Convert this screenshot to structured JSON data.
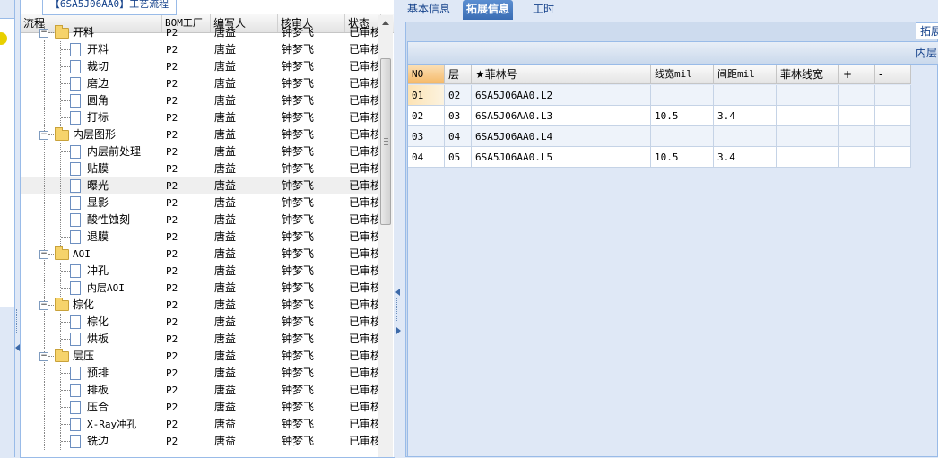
{
  "window": {
    "panel_tab_title": "【6SA5J06AA0】工艺流程"
  },
  "tree": {
    "columns": [
      "流程",
      "BOM工厂",
      "编写人",
      "核审人",
      "状态"
    ],
    "rows": [
      {
        "name": "开料",
        "type": "folder",
        "level": 0,
        "factory": "P2",
        "author": "唐益",
        "reviewer": "钟梦飞",
        "status": "已审核"
      },
      {
        "name": "开料",
        "type": "doc",
        "level": 1,
        "factory": "P2",
        "author": "唐益",
        "reviewer": "钟梦飞",
        "status": "已审核"
      },
      {
        "name": "裁切",
        "type": "doc",
        "level": 1,
        "factory": "P2",
        "author": "唐益",
        "reviewer": "钟梦飞",
        "status": "已审核"
      },
      {
        "name": "磨边",
        "type": "doc",
        "level": 1,
        "factory": "P2",
        "author": "唐益",
        "reviewer": "钟梦飞",
        "status": "已审核"
      },
      {
        "name": "圆角",
        "type": "doc",
        "level": 1,
        "factory": "P2",
        "author": "唐益",
        "reviewer": "钟梦飞",
        "status": "已审核"
      },
      {
        "name": "打标",
        "type": "doc",
        "level": 1,
        "factory": "P2",
        "author": "唐益",
        "reviewer": "钟梦飞",
        "status": "已审核"
      },
      {
        "name": "内层图形",
        "type": "folder",
        "level": 0,
        "factory": "P2",
        "author": "唐益",
        "reviewer": "钟梦飞",
        "status": "已审核"
      },
      {
        "name": "内层前处理",
        "type": "doc",
        "level": 1,
        "factory": "P2",
        "author": "唐益",
        "reviewer": "钟梦飞",
        "status": "已审核"
      },
      {
        "name": "贴膜",
        "type": "doc",
        "level": 1,
        "factory": "P2",
        "author": "唐益",
        "reviewer": "钟梦飞",
        "status": "已审核"
      },
      {
        "name": "曝光",
        "type": "doc",
        "level": 1,
        "factory": "P2",
        "author": "唐益",
        "reviewer": "钟梦飞",
        "status": "已审核",
        "selected": true
      },
      {
        "name": "显影",
        "type": "doc",
        "level": 1,
        "factory": "P2",
        "author": "唐益",
        "reviewer": "钟梦飞",
        "status": "已审核"
      },
      {
        "name": "酸性蚀刻",
        "type": "doc",
        "level": 1,
        "factory": "P2",
        "author": "唐益",
        "reviewer": "钟梦飞",
        "status": "已审核"
      },
      {
        "name": "退膜",
        "type": "doc",
        "level": 1,
        "factory": "P2",
        "author": "唐益",
        "reviewer": "钟梦飞",
        "status": "已审核"
      },
      {
        "name": "AOI",
        "type": "folder",
        "level": 0,
        "factory": "P2",
        "author": "唐益",
        "reviewer": "钟梦飞",
        "status": "已审核"
      },
      {
        "name": "冲孔",
        "type": "doc",
        "level": 1,
        "factory": "P2",
        "author": "唐益",
        "reviewer": "钟梦飞",
        "status": "已审核"
      },
      {
        "name": "内层AOI",
        "type": "doc",
        "level": 1,
        "factory": "P2",
        "author": "唐益",
        "reviewer": "钟梦飞",
        "status": "已审核"
      },
      {
        "name": "棕化",
        "type": "folder",
        "level": 0,
        "factory": "P2",
        "author": "唐益",
        "reviewer": "钟梦飞",
        "status": "已审核"
      },
      {
        "name": "棕化",
        "type": "doc",
        "level": 1,
        "factory": "P2",
        "author": "唐益",
        "reviewer": "钟梦飞",
        "status": "已审核"
      },
      {
        "name": "烘板",
        "type": "doc",
        "level": 1,
        "factory": "P2",
        "author": "唐益",
        "reviewer": "钟梦飞",
        "status": "已审核"
      },
      {
        "name": "层压",
        "type": "folder",
        "level": 0,
        "factory": "P2",
        "author": "唐益",
        "reviewer": "钟梦飞",
        "status": "已审核"
      },
      {
        "name": "预排",
        "type": "doc",
        "level": 1,
        "factory": "P2",
        "author": "唐益",
        "reviewer": "钟梦飞",
        "status": "已审核"
      },
      {
        "name": "排板",
        "type": "doc",
        "level": 1,
        "factory": "P2",
        "author": "唐益",
        "reviewer": "钟梦飞",
        "status": "已审核"
      },
      {
        "name": "压合",
        "type": "doc",
        "level": 1,
        "factory": "P2",
        "author": "唐益",
        "reviewer": "钟梦飞",
        "status": "已审核"
      },
      {
        "name": "X-Ray冲孔",
        "type": "doc",
        "level": 1,
        "factory": "P2",
        "author": "唐益",
        "reviewer": "钟梦飞",
        "status": "已审核"
      },
      {
        "name": "铣边",
        "type": "doc",
        "level": 1,
        "factory": "P2",
        "author": "唐益",
        "reviewer": "钟梦飞",
        "status": "已审核"
      }
    ]
  },
  "tabs": [
    {
      "label": "基本信息",
      "active": false
    },
    {
      "label": "拓展信息",
      "active": true
    },
    {
      "label": "工时",
      "active": false
    }
  ],
  "extension": {
    "subtab_label": "拓展",
    "grid_title": "内层",
    "columns": [
      "NO",
      "层",
      "★菲林号",
      "线宽mil",
      "间距mil",
      "菲林线宽",
      "+",
      "-"
    ],
    "rows": [
      {
        "no": "01",
        "layer": "02",
        "film": "6SA5J06AA0.L2",
        "width": "",
        "spacing": "",
        "film_width": "",
        "plus": "",
        "minus": ""
      },
      {
        "no": "02",
        "layer": "03",
        "film": "6SA5J06AA0.L3",
        "width": "10.5",
        "spacing": "3.4",
        "film_width": "",
        "plus": "",
        "minus": ""
      },
      {
        "no": "03",
        "layer": "04",
        "film": "6SA5J06AA0.L4",
        "width": "",
        "spacing": "",
        "film_width": "",
        "plus": "",
        "minus": ""
      },
      {
        "no": "04",
        "layer": "05",
        "film": "6SA5J06AA0.L5",
        "width": "10.5",
        "spacing": "3.4",
        "film_width": "",
        "plus": "",
        "minus": ""
      }
    ]
  }
}
